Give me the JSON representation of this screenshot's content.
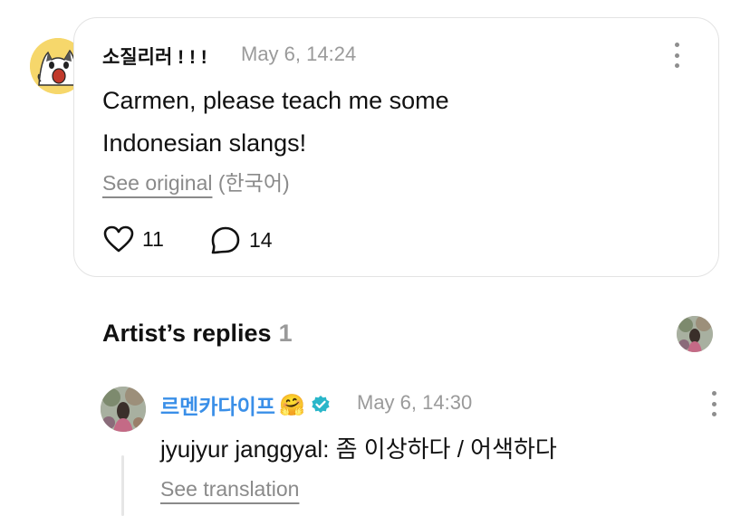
{
  "comment": {
    "author": "소질리러 ! ! !",
    "timestamp": "May 6, 14:24",
    "text_line1": "Carmen, please teach me some",
    "text_line2": "Indonesian slangs!",
    "see_original": "See original",
    "original_language": "(한국어)",
    "likes": "11",
    "replies": "14",
    "avatar_icon": "screaming-cat-avatar",
    "like_icon": "heart-icon",
    "reply_icon": "speech-bubble-icon"
  },
  "artist_replies": {
    "title": "Artist’s replies",
    "count": "1"
  },
  "reply": {
    "author": "르멘카다이프",
    "author_emoji": "🤗",
    "verified_icon": "verified-badge-icon",
    "timestamp": "May 6, 14:30",
    "text": "jyujyur janggyal: 좀 이상하다 / 어색하다",
    "see_translation": "See translation"
  },
  "colors": {
    "accent": "#3a8fe8",
    "muted": "#9a9a9a",
    "verified": "#29b6c9",
    "avatar_bg": "#f5d86a"
  }
}
